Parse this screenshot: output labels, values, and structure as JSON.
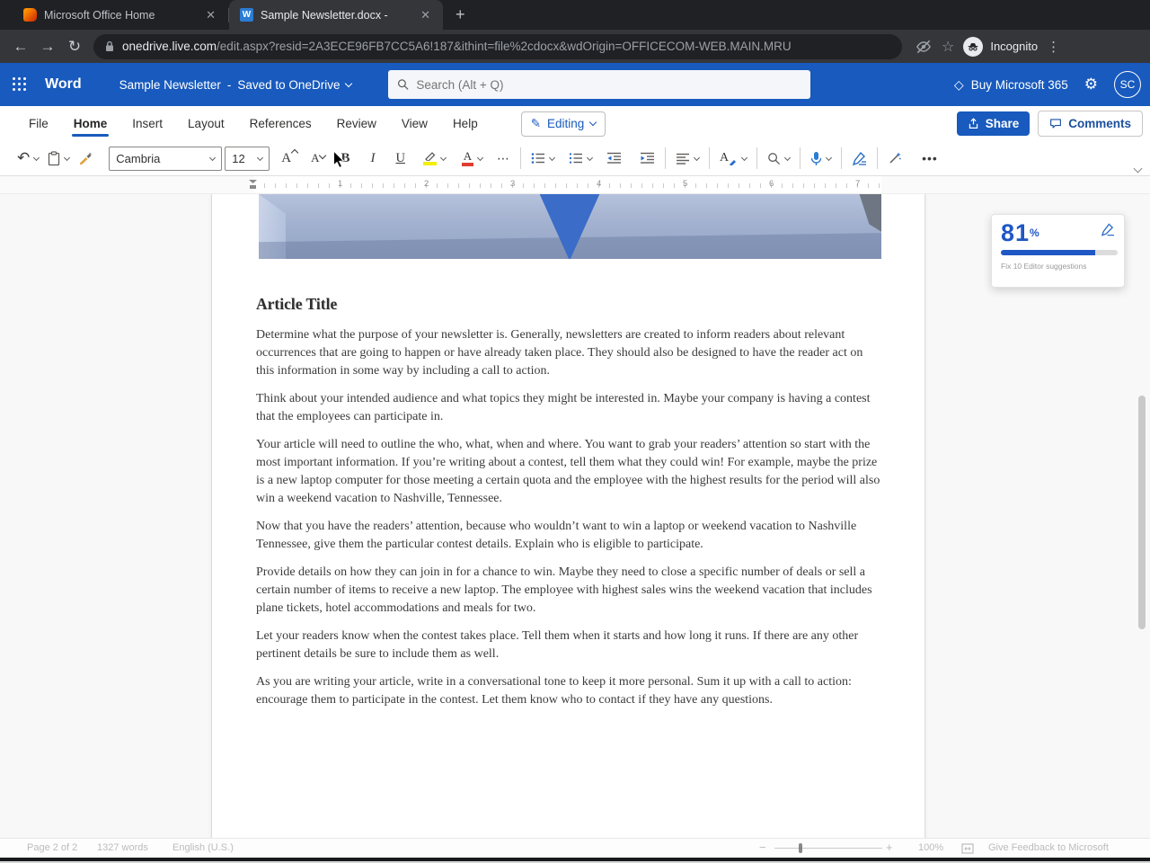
{
  "browser": {
    "tabs": [
      {
        "title": "Microsoft Office Home"
      },
      {
        "title": "Sample Newsletter.docx -"
      }
    ],
    "url_host": "onedrive.live.com",
    "url_path": "/edit.aspx?resid=2A3ECE96FB7CC5A6!187&ithint=file%2cdocx&wdOrigin=OFFICECOM-WEB.MAIN.MRU",
    "incognito_label": "Incognito"
  },
  "word_header": {
    "app_name": "Word",
    "doc_title": "Sample Newsletter",
    "separator": "-",
    "save_status": "Saved to OneDrive",
    "search_placeholder": "Search (Alt + Q)",
    "buy_label": "Buy Microsoft 365",
    "avatar_initials": "SC"
  },
  "menubar": {
    "items": [
      "File",
      "Home",
      "Insert",
      "Layout",
      "References",
      "Review",
      "View",
      "Help"
    ],
    "editing_label": "Editing",
    "share_label": "Share",
    "comments_label": "Comments"
  },
  "ribbon": {
    "font_name": "Cambria",
    "font_size": "12",
    "bold_label": "B",
    "italic_label": "I",
    "underline_label": "U",
    "grow_font_label": "A",
    "shrink_font_label": "A",
    "font_color_label": "A",
    "more_dots": "⋯"
  },
  "ruler": {
    "numbers": [
      "1",
      "2",
      "3",
      "4",
      "5",
      "6",
      "7"
    ]
  },
  "doc": {
    "heading": "Article Title",
    "paragraphs": [
      "Determine what the purpose of your newsletter is. Generally, newsletters are created to inform readers about relevant occurrences that are going to happen or have already taken place. They should also be designed to have the reader act on this information in some way by including a call to action.",
      "Think about your intended audience and what topics they might be interested in. Maybe your company is having a contest that the employees can participate in.",
      "Your article will need to outline the who, what, when and where. You want to grab your readers’ attention so start with the most important information. If you’re writing about a contest, tell them what they could win! For example, maybe the prize is a new laptop computer for those meeting a certain quota and the employee with the highest results for the period will also win a weekend vacation to Nashville, Tennessee.",
      "Now that you have the readers’ attention, because who wouldn’t want to win a laptop or weekend vacation to Nashville Tennessee, give them the particular contest details. Explain who is eligible to participate.",
      "Provide details on how they can join in for a chance to win. Maybe they need to close a specific number of deals or sell a certain number of items to receive a new laptop. The employee with highest sales wins the weekend vacation that includes plane tickets, hotel accommodations and meals for two.",
      "Let your readers know when the contest takes place. Tell them when it starts and how long it runs. If there are any other pertinent details be sure to include them as well.",
      "As you are writing your article, write in a conversational tone to keep it more personal. Sum it up with a call to action: encourage them to participate in the contest. Let them know who to contact if they have any questions."
    ]
  },
  "editor_popup": {
    "score": "81",
    "percent_sign": "%",
    "note": "Fix 10 Editor suggestions"
  },
  "statusbar": {
    "page_info": "Page 2 of 2",
    "word_count": "1327 words",
    "language": "English (U.S.)",
    "zoom_level": "100%",
    "feedback": "Give Feedback to Microsoft"
  },
  "colors": {
    "word_blue": "#185abd",
    "editor_score_blue": "#1f57c4",
    "highlight_yellow": "#f3ef0c",
    "font_color_red": "#e03c31"
  }
}
